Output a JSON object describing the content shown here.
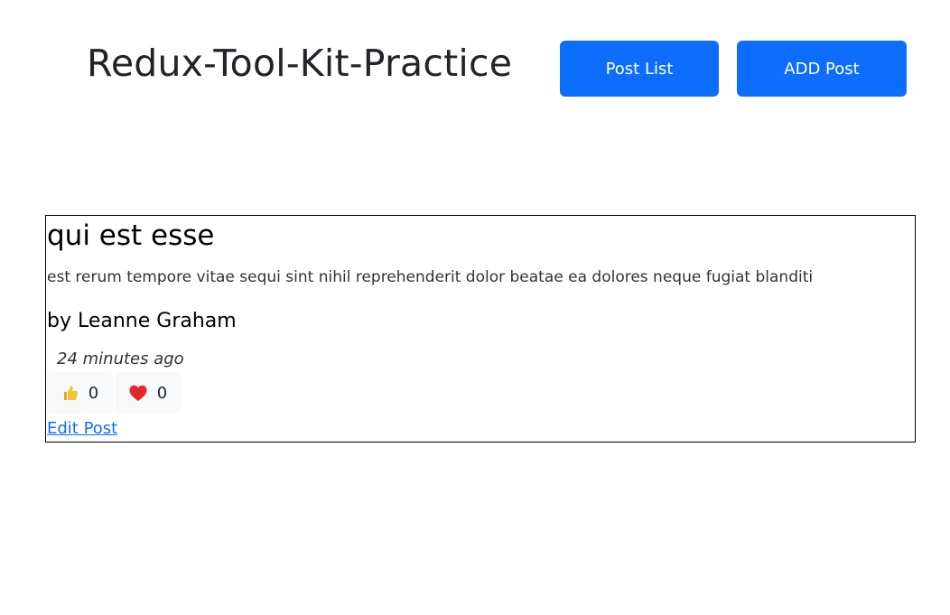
{
  "header": {
    "title": "Redux-Tool-Kit-Practice",
    "nav": {
      "post_list_label": "Post List",
      "add_post_label": "ADD Post"
    }
  },
  "post": {
    "title": "qui est esse",
    "body": "est rerum tempore vitae sequi sint nihil reprehenderit dolor beatae ea dolores neque fugiat blanditi",
    "author": "by Leanne Graham",
    "time": "24 minutes ago",
    "reactions": {
      "thumbs_up": {
        "icon": "thumbs-up-icon",
        "count": "0"
      },
      "heart": {
        "icon": "heart-icon",
        "count": "0"
      }
    },
    "edit_link_label": "Edit Post"
  },
  "colors": {
    "primary": "#0d6efd",
    "heart": "#e8262a",
    "thumb": "#f5c33b"
  }
}
